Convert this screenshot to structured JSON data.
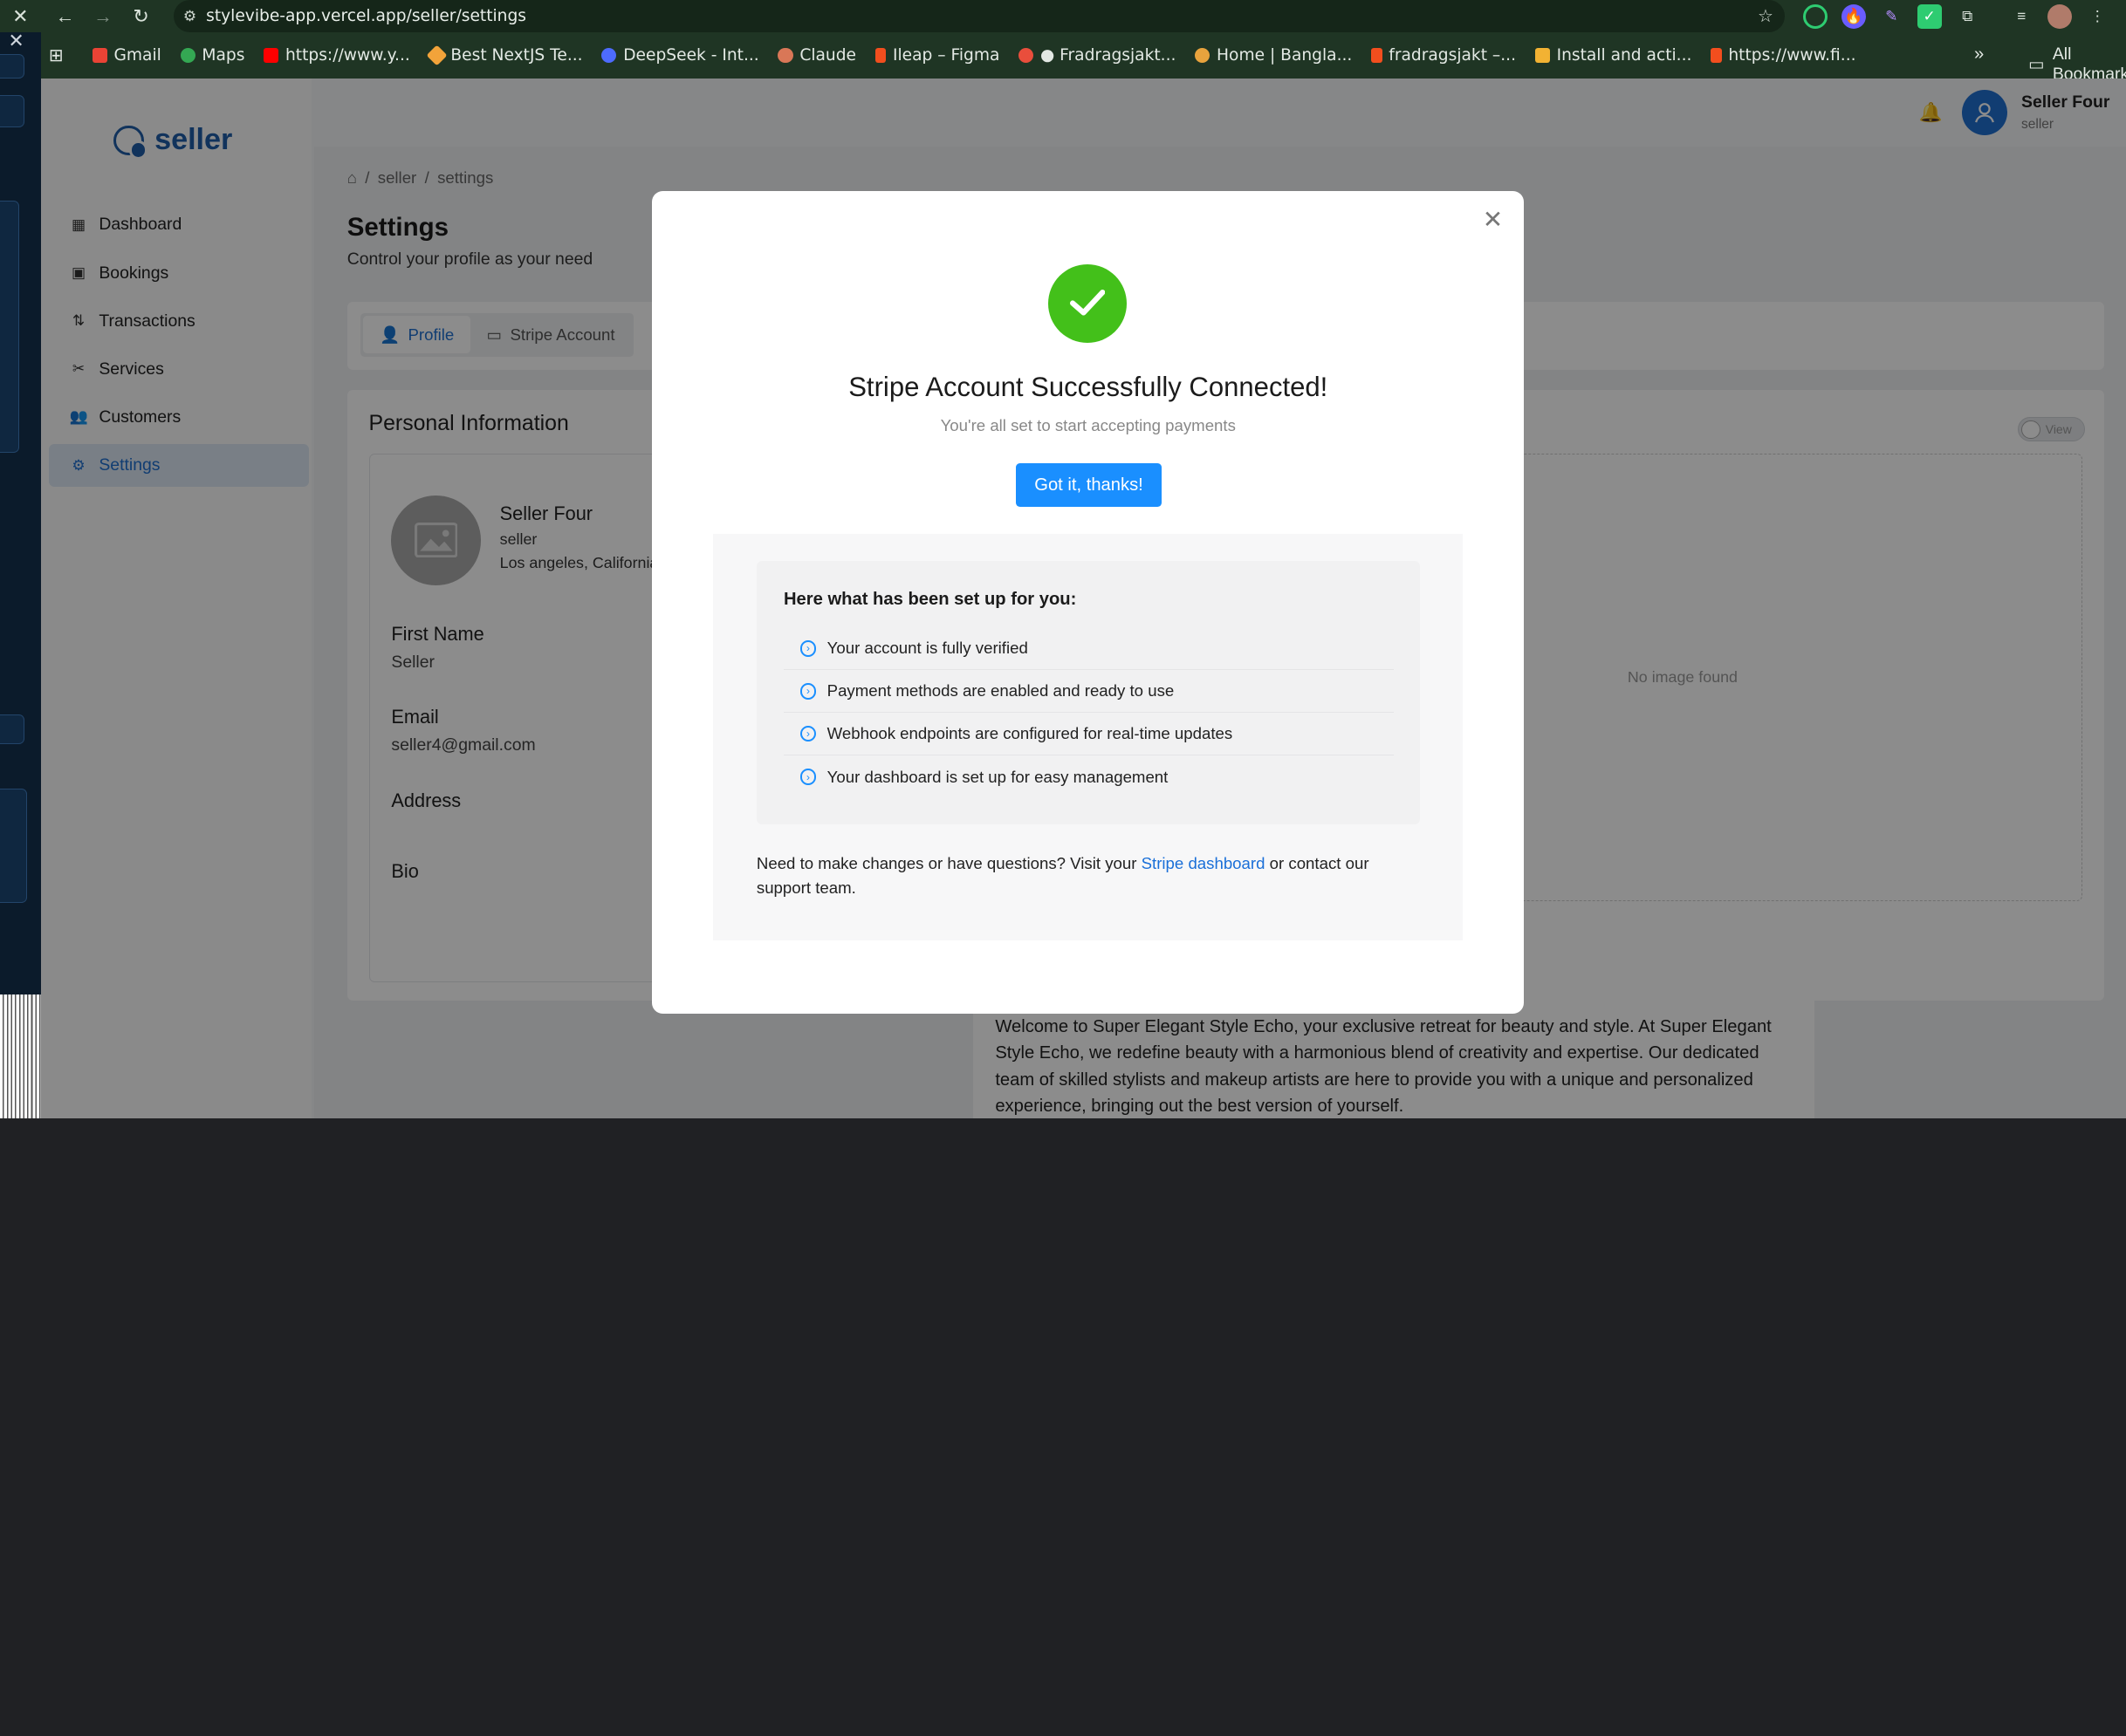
{
  "browser": {
    "url": "stylevibe-app.vercel.app/seller/settings",
    "bookmarks": [
      {
        "label": "Gmail",
        "color": "#ea4335"
      },
      {
        "label": "Maps",
        "color": "#34a853"
      },
      {
        "label": "https://www.y...",
        "color": "#ff0000"
      },
      {
        "label": "Best NextJS Te...",
        "color": "#f2a33a"
      },
      {
        "label": "DeepSeek - Int...",
        "color": "#4d6bfe"
      },
      {
        "label": "Claude",
        "color": "#d97757"
      },
      {
        "label": "Ileap – Figma",
        "color": "#f24e1e"
      },
      {
        "label": "● Fradragsjakt...",
        "color": "#e94e3c"
      },
      {
        "label": "Home | Bangla...",
        "color": "#e8a33d"
      },
      {
        "label": "fradragsjakt –...",
        "color": "#f24e1e"
      },
      {
        "label": "Install and acti...",
        "color": "#f2b233"
      },
      {
        "label": "https://www.fi...",
        "color": "#f24e1e"
      }
    ],
    "all_bookmarks": "All Bookmarks",
    "more": "»"
  },
  "app": {
    "logo": "seller",
    "menu": [
      {
        "label": "Dashboard",
        "icon": "grid-icon"
      },
      {
        "label": "Bookings",
        "icon": "bookings-icon"
      },
      {
        "label": "Transactions",
        "icon": "transactions-icon"
      },
      {
        "label": "Services",
        "icon": "services-icon"
      },
      {
        "label": "Customers",
        "icon": "customers-icon"
      },
      {
        "label": "Settings",
        "icon": "gear-icon",
        "active": true
      }
    ],
    "user": {
      "name": "Seller Four",
      "role": "seller"
    }
  },
  "page": {
    "breadcrumb": [
      "seller",
      "settings"
    ],
    "title": "Settings",
    "subtitle": "Control your profile as your need",
    "tabs": [
      "Profile",
      "Stripe Account"
    ],
    "section_title": "Personal Information",
    "view_toggle": "View",
    "no_image": "No image found",
    "profile": {
      "name": "Seller Four",
      "role": "seller",
      "location": "Los angeles, California"
    },
    "fields": {
      "first_name_label": "First Name",
      "first_name_value": "Seller",
      "email_label": "Email",
      "email_value": "seller4@gmail.com",
      "address_label": "Address",
      "bio_label": "Bio"
    },
    "bio_text": "Welcome to Super Elegant Style Echo, your exclusive retreat for beauty and style. At Super Elegant Style Echo, we redefine beauty with a harmonious blend of creativity and expertise. Our dedicated team of skilled stylists and makeup artists are here to provide you with a unique and personalized experience, bringing out the best version of yourself."
  },
  "modal": {
    "title": "Stripe Account Successfully Connected!",
    "subtitle": "You're all set to start accepting payments",
    "button": "Got it, thanks!",
    "setup_title": "Here what has been set up for you:",
    "setup_items": [
      "Your account is fully verified",
      "Payment methods are enabled and ready to use",
      "Webhook endpoints are configured for real-time updates",
      "Your dashboard is set up for easy management"
    ],
    "help_before": "Need to make changes or have questions? Visit your ",
    "help_link": "Stripe dashboard",
    "help_after": " or contact our support team.",
    "accent": "#1a8fff",
    "success": "#43c01a"
  }
}
